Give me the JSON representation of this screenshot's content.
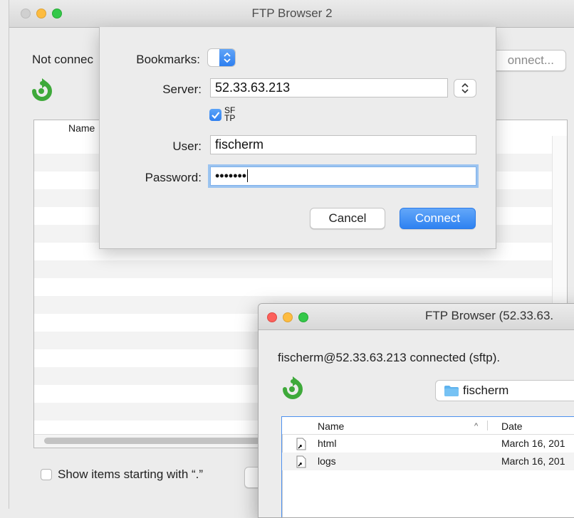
{
  "back_window": {
    "title": "FTP Browser 2",
    "status": "Not connec",
    "connect_button": "onnect...",
    "list_header_name": "Name",
    "show_hidden_label": "Show items starting with “.”"
  },
  "sheet": {
    "bookmarks_label": "Bookmarks:",
    "server_label": "Server:",
    "server_value": "52.33.63.213",
    "sftp_label": "SFTP",
    "sftp_checked": true,
    "user_label": "User:",
    "user_value": "fischerm",
    "password_label": "Password:",
    "password_value": "•••••••",
    "cancel_button": "Cancel",
    "connect_button": "Connect"
  },
  "front_window": {
    "title": "FTP Browser (52.33.63.",
    "status": "fischerm@52.33.63.213 connected (sftp).",
    "path": "fischerm",
    "columns": {
      "name": "Name",
      "date": "Date"
    },
    "rows": [
      {
        "name": "html",
        "date": "March 16, 201"
      },
      {
        "name": "logs",
        "date": "March 16, 201"
      }
    ]
  },
  "icons": {
    "refresh": "refresh-icon",
    "folder": "folder-icon",
    "file_alias": "file-alias-icon",
    "updown": "chevron-up-down-icon"
  },
  "colors": {
    "accent": "#2e82f1",
    "refresh_green": "#3ea93a",
    "folder_blue": "#5fb3ee"
  }
}
